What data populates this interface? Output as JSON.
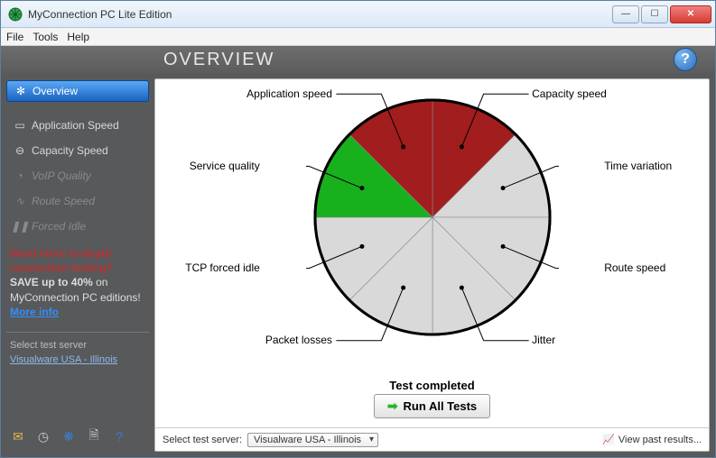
{
  "window": {
    "title": "MyConnection PC Lite Edition"
  },
  "menu": {
    "file": "File",
    "tools": "Tools",
    "help": "Help"
  },
  "header": {
    "title": "OVERVIEW"
  },
  "sidebar": {
    "items": [
      {
        "label": "Overview",
        "active": true
      },
      {
        "label": "Application Speed"
      },
      {
        "label": "Capacity Speed"
      },
      {
        "label": "VoIP Quality",
        "disabled": true
      },
      {
        "label": "Route Speed",
        "disabled": true
      },
      {
        "label": "Forced Idle",
        "disabled": true
      }
    ],
    "promo_line1": "Need more in-depth connection testing?",
    "promo_line2_a": "SAVE up to 40%",
    "promo_line2_b": " on MyConnection PC editions! ",
    "promo_link": "More info",
    "select_label": "Select test server",
    "server_link": "Visualware USA - Illinois"
  },
  "chart_data": {
    "type": "pie",
    "title": "",
    "slices": [
      {
        "label": "Capacity speed",
        "angle_deg": 45,
        "color": "#a21d1d",
        "status": "fail"
      },
      {
        "label": "Time variation",
        "angle_deg": 45,
        "color": "#d9d9d9",
        "status": "not-run"
      },
      {
        "label": "Route speed",
        "angle_deg": 45,
        "color": "#d9d9d9",
        "status": "not-run"
      },
      {
        "label": "Jitter",
        "angle_deg": 45,
        "color": "#d9d9d9",
        "status": "not-run"
      },
      {
        "label": "Packet losses",
        "angle_deg": 45,
        "color": "#d9d9d9",
        "status": "not-run"
      },
      {
        "label": "TCP forced idle",
        "angle_deg": 45,
        "color": "#d9d9d9",
        "status": "not-run"
      },
      {
        "label": "Service quality",
        "angle_deg": 45,
        "color": "#19b01e",
        "status": "pass"
      },
      {
        "label": "Application speed",
        "angle_deg": 45,
        "color": "#a21d1d",
        "status": "fail"
      }
    ]
  },
  "status": {
    "text": "Test completed",
    "run_button": "Run All Tests"
  },
  "bottom": {
    "select_label": "Select test server:",
    "server_value": "Visualware USA - Illinois",
    "past_link": "View past results..."
  }
}
